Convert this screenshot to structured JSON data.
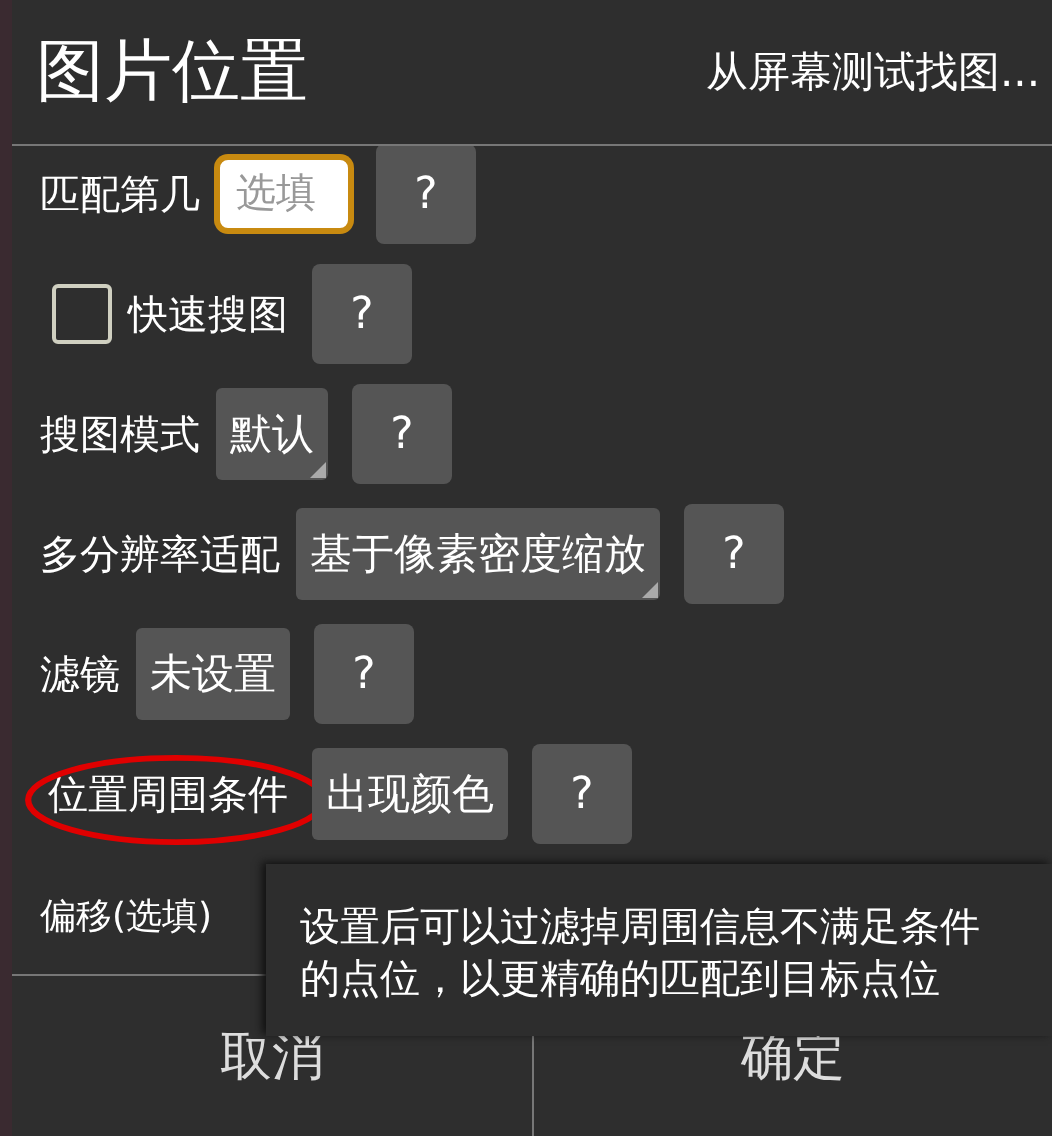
{
  "dialog": {
    "title": "图片位置",
    "action": "从屏幕测试找图..."
  },
  "rows": [
    {
      "kind": "input",
      "label": "匹配第几",
      "placeholder": "选填",
      "focused": true,
      "help": "?"
    },
    {
      "kind": "checkbox",
      "label": "快速搜图",
      "checked": false,
      "help": "?"
    },
    {
      "kind": "dropdown",
      "label": "搜图模式",
      "value": "默认",
      "help": "?"
    },
    {
      "kind": "dropdown",
      "label": "多分辨率适配",
      "value": "基于像素密度缩放",
      "help": "?"
    },
    {
      "kind": "button",
      "label": "滤镜",
      "value": "未设置",
      "help": "?"
    },
    {
      "kind": "button",
      "label": "位置周围条件",
      "value": "出现颜色",
      "help": "?",
      "circled": true
    },
    {
      "kind": "plain",
      "label": "偏移(选填)"
    }
  ],
  "tooltip": "设置后可以过滤掉周围信息不满足条件的点位，以更精确的匹配到目标点位",
  "buttons": [
    "取消",
    "确定"
  ]
}
